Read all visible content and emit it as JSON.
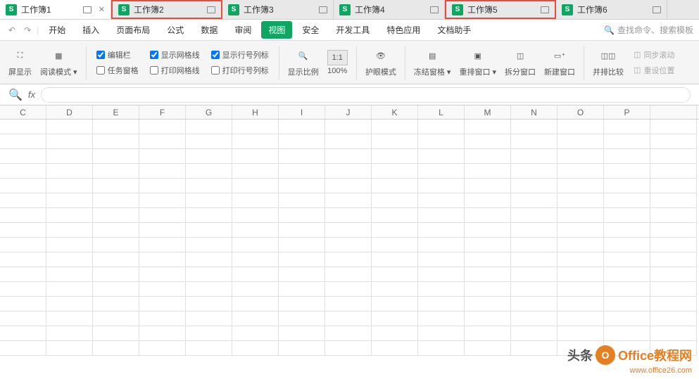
{
  "tabs": [
    {
      "label": "工作簿1",
      "active": true
    },
    {
      "label": "工作簿2",
      "highlighted": true
    },
    {
      "label": "工作簿3"
    },
    {
      "label": "工作簿4"
    },
    {
      "label": "工作簿5",
      "highlighted": true
    },
    {
      "label": "工作簿6"
    }
  ],
  "menu": {
    "items": [
      "开始",
      "插入",
      "页面布局",
      "公式",
      "数据",
      "审阅",
      "视图",
      "安全",
      "开发工具",
      "特色应用",
      "文档助手"
    ],
    "active": "视图",
    "search_placeholder": "查找命令、搜索模板"
  },
  "ribbon": {
    "fullscreen": "屏显示",
    "read_mode": "阅读模式",
    "checks": {
      "edit_bar": "编辑栏",
      "task_pane": "任务窗格",
      "show_grid": "显示网格线",
      "print_grid": "打印网格线",
      "show_rowcol": "显示行号列标",
      "print_rowcol": "打印行号列标"
    },
    "zoom_ratio": "显示比例",
    "zoom_value": "100%",
    "eye_mode": "护眼模式",
    "freeze": "冻结窗格",
    "rearrange": "重排窗口",
    "split": "拆分窗口",
    "new_window": "新建窗口",
    "compare": "并排比较",
    "sync_scroll": "同步滚动",
    "reset_pos": "重设位置"
  },
  "formula": {
    "fx": "fx"
  },
  "columns": [
    "C",
    "D",
    "E",
    "F",
    "G",
    "H",
    "I",
    "J",
    "K",
    "L",
    "M",
    "N",
    "O",
    "P"
  ],
  "watermark": {
    "text1": "头条",
    "text2": "Office教程网",
    "url": "www.office26.com"
  }
}
